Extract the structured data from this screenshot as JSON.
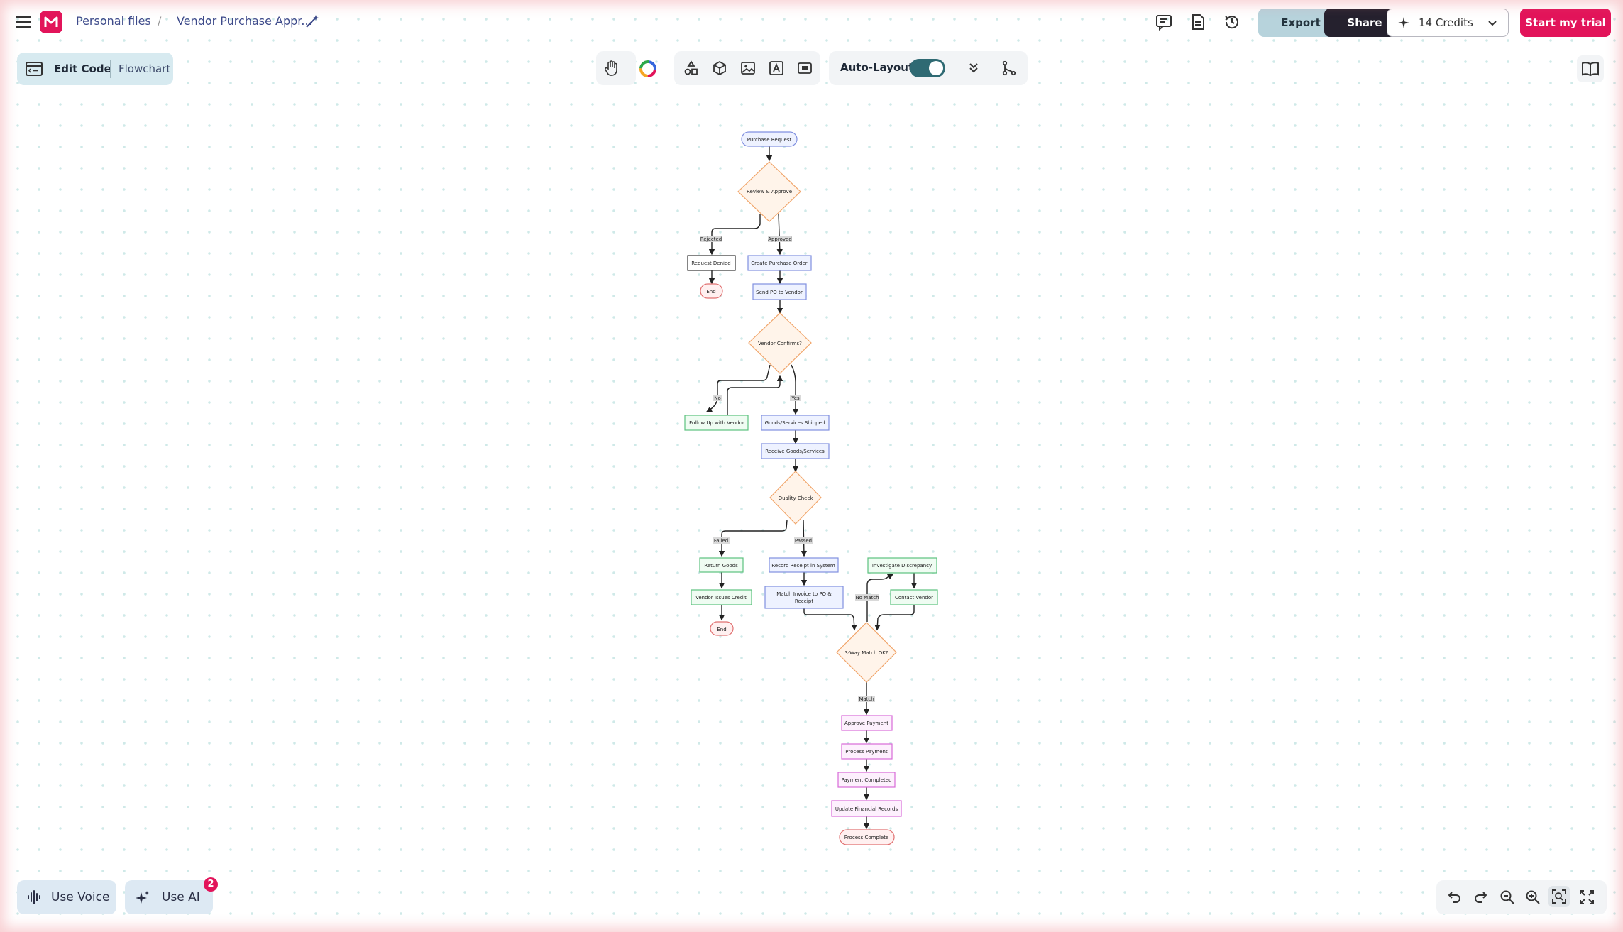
{
  "topbar": {
    "breadcrumb_root": "Personal files",
    "breadcrumb_separator": "/",
    "document_title": "Vendor Purchase Appr...",
    "export_label": "Export",
    "share_label": "Share",
    "credits_label": "14 Credits",
    "trial_label": "Start my trial"
  },
  "mode_panel": {
    "edit_code_label": "Edit Code",
    "diagram_type_label": "Flowchart"
  },
  "toolbar": {
    "auto_layout_label": "Auto-Layout",
    "auto_layout_enabled": true
  },
  "bottom": {
    "voice_label": "Use Voice",
    "ai_label": "Use AI",
    "ai_badge_count": "2"
  },
  "colors": {
    "brand": "#e2145a",
    "export_bg": "#b7d3dc",
    "share_bg": "#25212e",
    "toggle_on": "#2f6a73"
  },
  "icons": [
    "menu-icon",
    "logo-icon",
    "magic-wand-icon",
    "comment-icon",
    "document-icon",
    "history-icon",
    "sparkle-icon",
    "chevron-down-icon",
    "code-icon",
    "hand-icon",
    "color-wheel-icon",
    "shapes-icon",
    "cube-icon",
    "image-icon",
    "text-icon",
    "frame-icon",
    "double-chevron-icon",
    "branch-icon",
    "book-icon",
    "voice-icon",
    "undo-icon",
    "redo-icon",
    "zoom-out-icon",
    "zoom-in-icon",
    "fit-screen-icon",
    "fullscreen-icon"
  ],
  "flowchart": {
    "nodes": {
      "purchase_request": "Purchase Request",
      "review_approve": "Review & Approve",
      "request_denied": "Request Denied",
      "end_1": "End",
      "create_po": "Create Purchase Order",
      "send_po": "Send PO to Vendor",
      "vendor_confirms": "Vendor Confirms?",
      "follow_up": "Follow Up with Vendor",
      "goods_shipped": "Goods/Services Shipped",
      "receive_goods": "Receive Goods/Services",
      "quality_check": "Quality Check",
      "return_goods": "Return Goods",
      "vendor_credit": "Vendor Issues Credit",
      "end_2": "End",
      "record_receipt": "Record Receipt in System",
      "match_invoice_1": "Match Invoice to PO &",
      "match_invoice_2": "Receipt",
      "investigate": "Investigate Discrepancy",
      "contact_vendor": "Contact Vendor",
      "three_way": "3-Way Match OK?",
      "approve_payment": "Approve Payment",
      "process_payment": "Process Payment",
      "payment_completed": "Payment Completed",
      "update_records": "Update Financial Records",
      "process_complete": "Process Complete"
    },
    "edge_labels": {
      "rejected": "Rejected",
      "approved": "Approved",
      "no": "No",
      "yes": "Yes",
      "failed": "Failed",
      "passed": "Passed",
      "no_match": "No Match",
      "match": "Match"
    }
  }
}
